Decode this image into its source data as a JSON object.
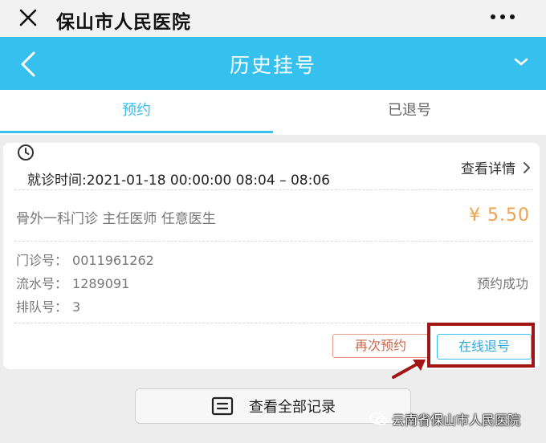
{
  "wechat_bar": {
    "title": "保山市人民医院"
  },
  "header": {
    "title": "历史挂号"
  },
  "tabs": [
    {
      "label": "预约",
      "active": true
    },
    {
      "label": "已退号",
      "active": false
    }
  ],
  "record": {
    "visit_time": "就诊时间:2021-01-18 00:00:00 08:04 – 08:06",
    "details_label": "查看详情",
    "department": "骨外一科门诊 主任医师 任意医生",
    "price": "¥ 5.50",
    "outpatient_no_label": "门诊号：",
    "outpatient_no": "0011961262",
    "serial_no_label": "流水号：",
    "serial_no": "1289091",
    "queue_no_label": "排队号：",
    "queue_no": "3",
    "status": "预约成功",
    "rebook_label": "再次预约",
    "cancel_label": "在线退号"
  },
  "view_all_label": "查看全部记录",
  "watermark": "云南省保山市人民医院",
  "colors": {
    "header": "#36c0ee",
    "price": "#f0a14c",
    "highlight": "#a11515"
  }
}
